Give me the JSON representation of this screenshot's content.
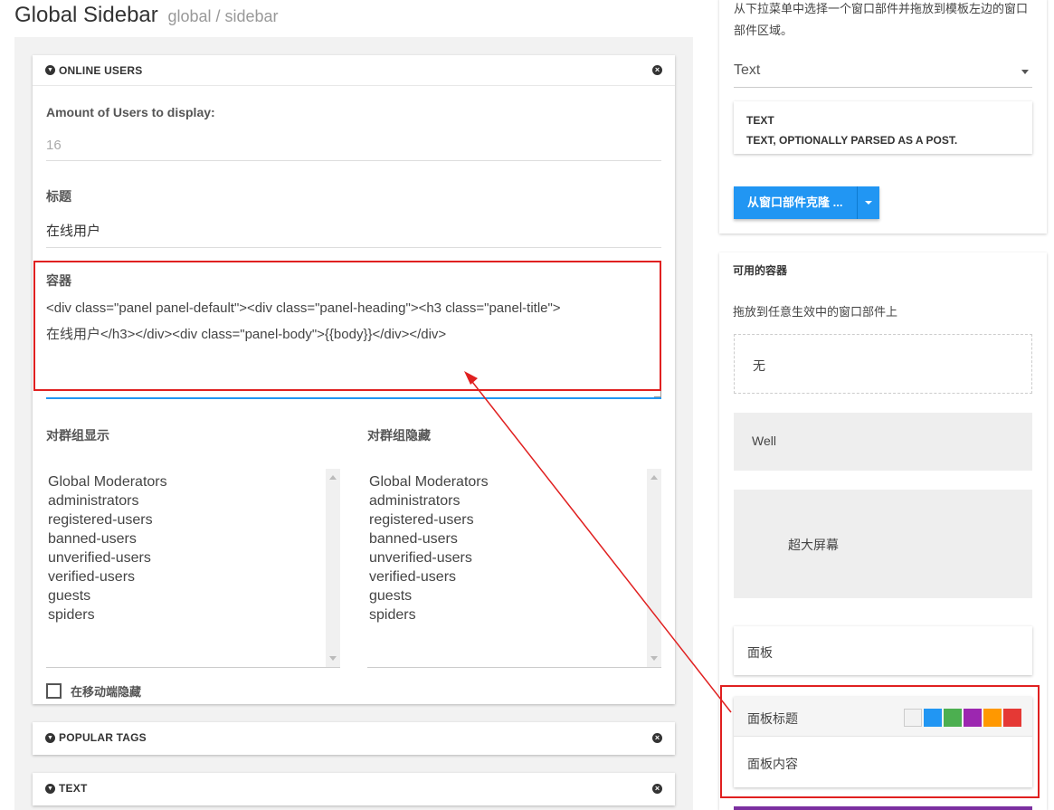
{
  "header": {
    "title": "Global Sidebar",
    "subtitle": "global / sidebar"
  },
  "online_users_panel": {
    "title": "ONLINE USERS",
    "amount_label": "Amount of Users to display:",
    "amount_value": "16",
    "heading_label": "标题",
    "heading_value": "在线用户",
    "container_label": "容器",
    "container_line1": "<div class=\"panel panel-default\"><div class=\"panel-heading\"><h3 class=\"panel-title\">",
    "container_line2": "在线用户</h3></div><div class=\"panel-body\">{{body}}</div></div>",
    "show_groups_label": "对群组显示",
    "hide_groups_label": "对群组隐藏",
    "groups": [
      "Global Moderators",
      "administrators",
      "registered-users",
      "banned-users",
      "unverified-users",
      "verified-users",
      "guests",
      "spiders"
    ],
    "hide_mobile_label": "在移动端隐藏"
  },
  "popular_tags_panel": {
    "title": "POPULAR TAGS"
  },
  "text_panel": {
    "title": "TEXT"
  },
  "widget_picker": {
    "description": "从下拉菜单中选择一个窗口部件并拖放到模板左边的窗口部件区域。",
    "selected_widget": "Text",
    "info_title": "TEXT",
    "info_desc": "TEXT, OPTIONALLY PARSED AS A POST.",
    "clone_button": "从窗口部件克隆 ..."
  },
  "containers": {
    "title": "可用的容器",
    "hint": "拖放到任意生效中的窗口部件上",
    "items": [
      "无",
      "Well",
      "超大屏幕",
      "面板"
    ],
    "panel_heading": "面板标题",
    "panel_body": "面板内容",
    "swatch_colors": [
      "#f2f2f2",
      "#2196f3",
      "#4caf50",
      "#9c27b0",
      "#ff9800",
      "#e53935"
    ]
  },
  "colors": {
    "accent": "#2196f3",
    "annotation_red": "#e02020"
  }
}
